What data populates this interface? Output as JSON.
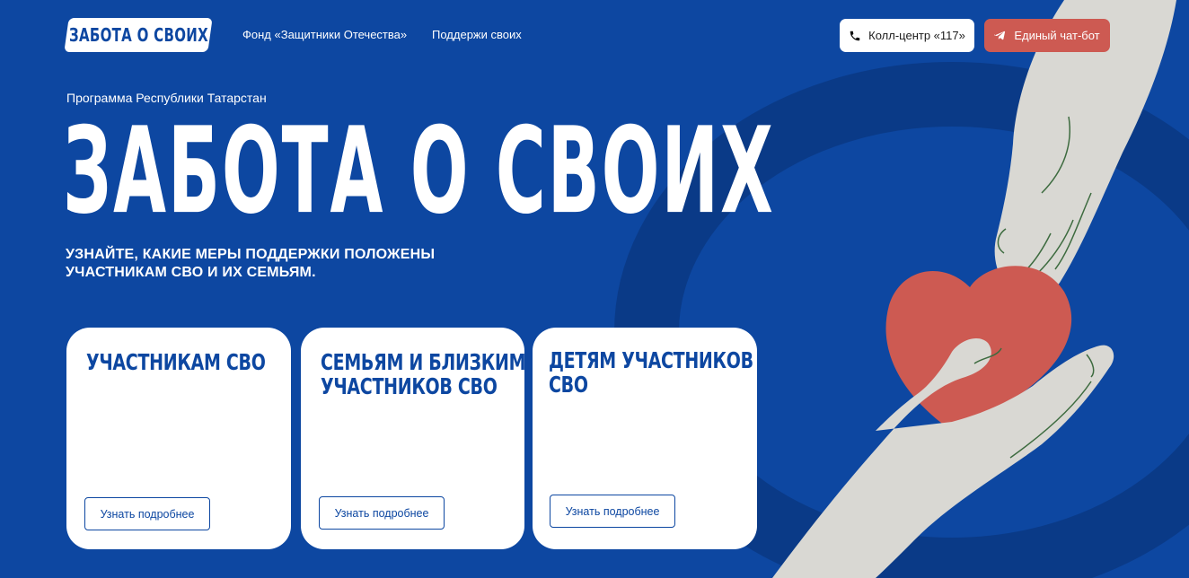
{
  "header": {
    "logo_text": "ЗАБОТА О СВОИХ",
    "nav": [
      {
        "label": "Фонд «Защитники Отечества»"
      },
      {
        "label": "Поддержи своих"
      }
    ],
    "call_center_label": "Колл-центр «117»",
    "chatbot_label": "Единый чат-бот"
  },
  "hero": {
    "program_label": "Программа Республики Татарстан",
    "title": "ЗАБОТА О СВОИХ",
    "subtitle": "УЗНАЙТЕ, КАКИЕ МЕРЫ ПОДДЕРЖКИ ПОЛОЖЕНЫ УЧАСТНИКАМ СВО И ИХ СЕМЬЯМ."
  },
  "cards": [
    {
      "title": "Участникам СВО",
      "button_label": "Узнать подробнее"
    },
    {
      "title": "Семьям и близким участников СВО",
      "button_label": "Узнать подробнее"
    },
    {
      "title": "Детям участников СВО",
      "button_label": "Узнать подробнее"
    }
  ],
  "icons": {
    "phone": "phone-icon",
    "telegram": "telegram-icon",
    "illustration": "hands-heart-illustration"
  },
  "colors": {
    "background": "#0d47a1",
    "accent_red": "#cd5a52",
    "card_bg": "#ffffff",
    "text_blue": "#0d47a1"
  }
}
